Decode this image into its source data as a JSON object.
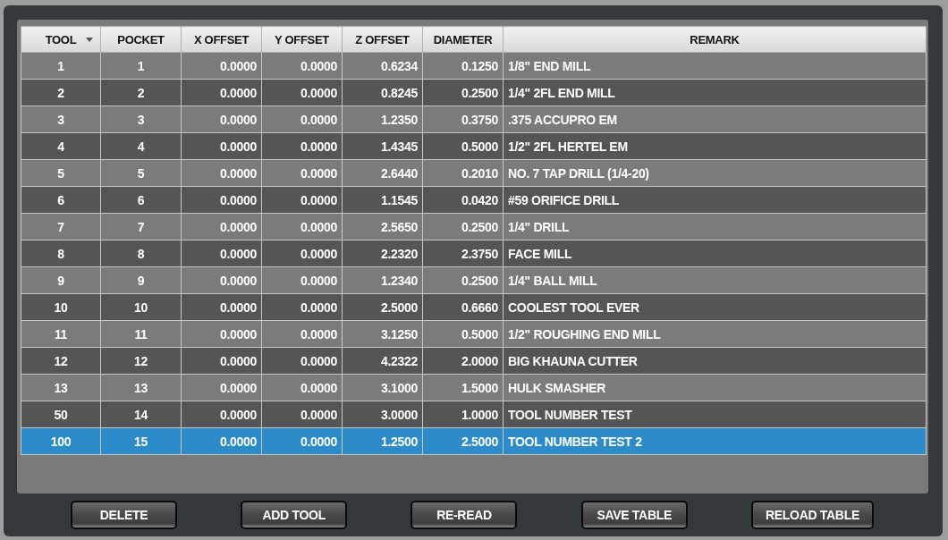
{
  "table": {
    "columns": [
      {
        "label": "TOOL",
        "sorted": true
      },
      {
        "label": "POCKET",
        "sorted": false
      },
      {
        "label": "X OFFSET",
        "sorted": false
      },
      {
        "label": "Y OFFSET",
        "sorted": false
      },
      {
        "label": "Z OFFSET",
        "sorted": false
      },
      {
        "label": "DIAMETER",
        "sorted": false
      },
      {
        "label": "REMARK",
        "sorted": false
      }
    ],
    "rows": [
      {
        "cells": [
          "1",
          "1",
          "0.0000",
          "0.0000",
          "0.6234",
          "0.1250",
          "1/8\" END MILL"
        ],
        "selected": false
      },
      {
        "cells": [
          "2",
          "2",
          "0.0000",
          "0.0000",
          "0.8245",
          "0.2500",
          "1/4\" 2FL END MILL"
        ],
        "selected": false
      },
      {
        "cells": [
          "3",
          "3",
          "0.0000",
          "0.0000",
          "1.2350",
          "0.3750",
          ".375 ACCUPRO EM"
        ],
        "selected": false
      },
      {
        "cells": [
          "4",
          "4",
          "0.0000",
          "0.0000",
          "1.4345",
          "0.5000",
          "1/2\" 2FL HERTEL EM"
        ],
        "selected": false
      },
      {
        "cells": [
          "5",
          "5",
          "0.0000",
          "0.0000",
          "2.6440",
          "0.2010",
          "NO. 7 TAP DRILL (1/4-20)"
        ],
        "selected": false
      },
      {
        "cells": [
          "6",
          "6",
          "0.0000",
          "0.0000",
          "1.1545",
          "0.0420",
          "#59 ORIFICE DRILL"
        ],
        "selected": false
      },
      {
        "cells": [
          "7",
          "7",
          "0.0000",
          "0.0000",
          "2.5650",
          "0.2500",
          "1/4\" DRILL"
        ],
        "selected": false
      },
      {
        "cells": [
          "8",
          "8",
          "0.0000",
          "0.0000",
          "2.2320",
          "2.3750",
          "FACE MILL"
        ],
        "selected": false
      },
      {
        "cells": [
          "9",
          "9",
          "0.0000",
          "0.0000",
          "1.2340",
          "0.2500",
          "1/4\" BALL MILL"
        ],
        "selected": false
      },
      {
        "cells": [
          "10",
          "10",
          "0.0000",
          "0.0000",
          "2.5000",
          "0.6660",
          "COOLEST TOOL EVER"
        ],
        "selected": false
      },
      {
        "cells": [
          "11",
          "11",
          "0.0000",
          "0.0000",
          "3.1250",
          "0.5000",
          "1/2\" ROUGHING END MILL"
        ],
        "selected": false
      },
      {
        "cells": [
          "12",
          "12",
          "0.0000",
          "0.0000",
          "4.2322",
          "2.0000",
          "BIG KHAUNA CUTTER"
        ],
        "selected": false
      },
      {
        "cells": [
          "13",
          "13",
          "0.0000",
          "0.0000",
          "3.1000",
          "1.5000",
          "HULK SMASHER"
        ],
        "selected": false
      },
      {
        "cells": [
          "50",
          "14",
          "0.0000",
          "0.0000",
          "3.0000",
          "1.0000",
          "TOOL NUMBER TEST"
        ],
        "selected": false
      },
      {
        "cells": [
          "100",
          "15",
          "0.0000",
          "0.0000",
          "1.2500",
          "2.5000",
          "TOOL NUMBER TEST 2"
        ],
        "selected": true
      }
    ]
  },
  "buttons": [
    "DELETE",
    "ADD TOOL",
    "RE-READ",
    "SAVE TABLE",
    "RELOAD TABLE"
  ]
}
